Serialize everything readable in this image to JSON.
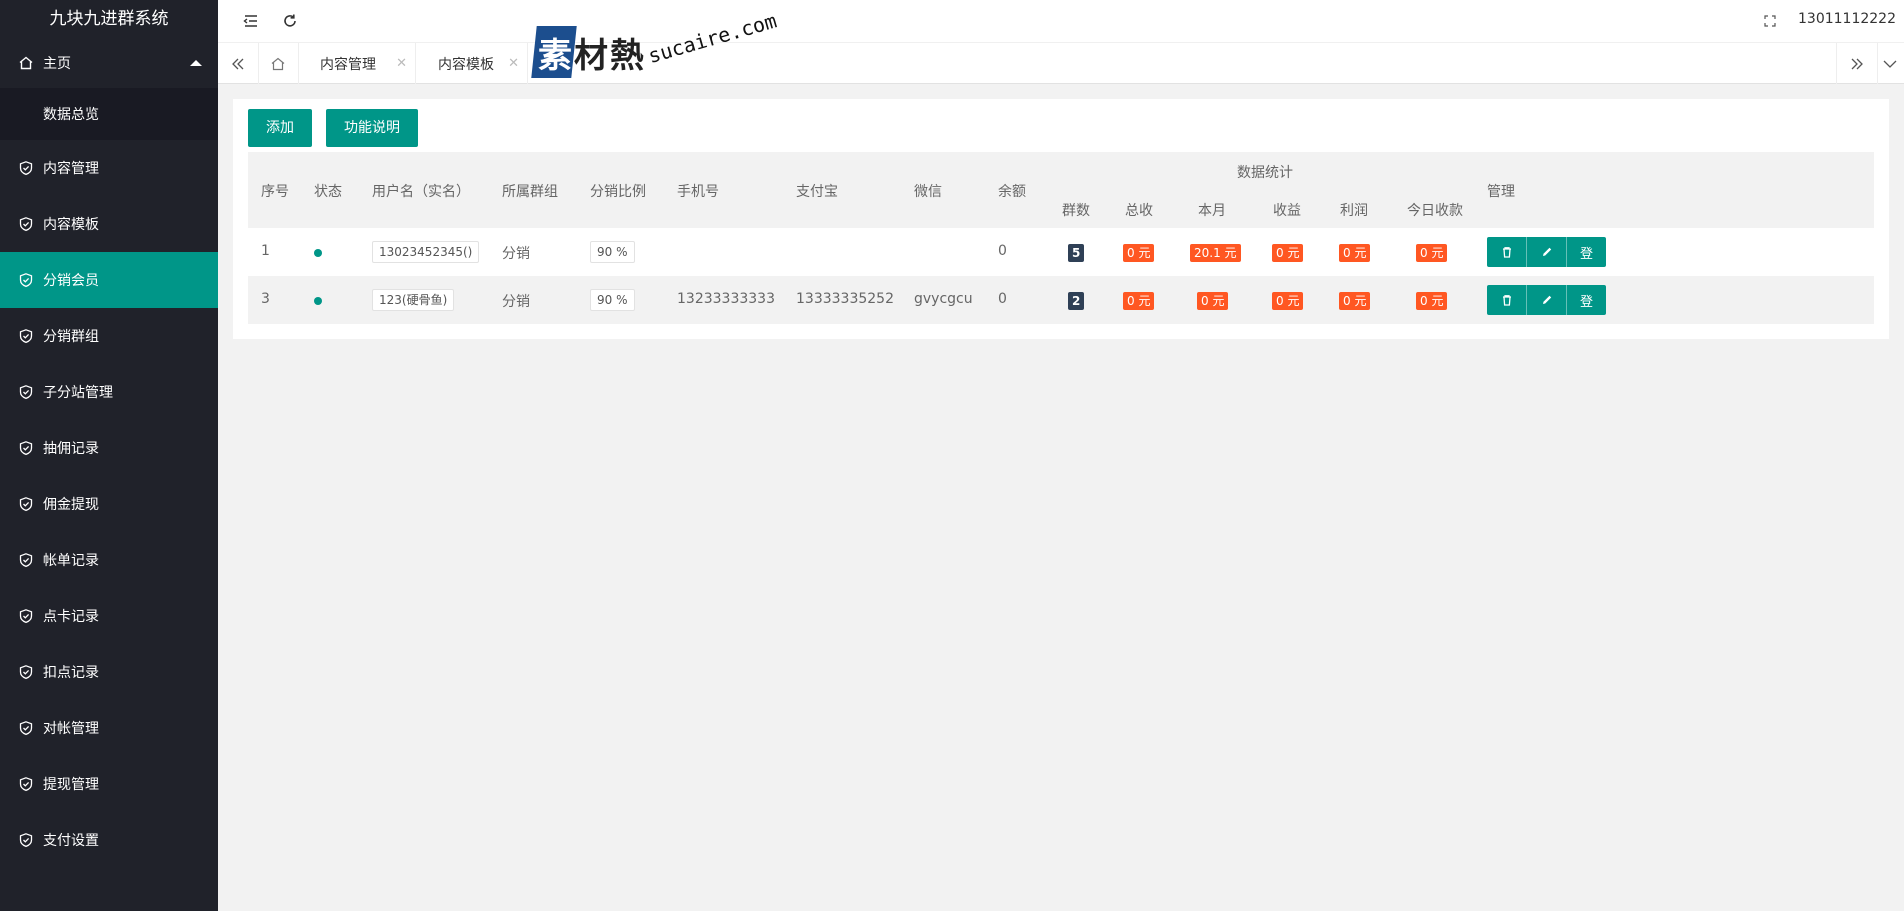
{
  "app": {
    "title": "九块九进群系统"
  },
  "sidebar": {
    "home": {
      "label": "主页",
      "sub": "数据总览"
    },
    "items": [
      {
        "label": "内容管理",
        "active": false
      },
      {
        "label": "内容模板",
        "active": false
      },
      {
        "label": "分销会员",
        "active": true
      },
      {
        "label": "分销群组",
        "active": false
      },
      {
        "label": "子分站管理",
        "active": false
      },
      {
        "label": "抽佣记录",
        "active": false
      },
      {
        "label": "佣金提现",
        "active": false
      },
      {
        "label": "帐单记录",
        "active": false
      },
      {
        "label": "点卡记录",
        "active": false
      },
      {
        "label": "扣点记录",
        "active": false
      },
      {
        "label": "对帐管理",
        "active": false
      },
      {
        "label": "提现管理",
        "active": false
      },
      {
        "label": "支付设置",
        "active": false
      }
    ]
  },
  "header": {
    "user_phone": "13011112222"
  },
  "tabs": [
    {
      "label": "内容管理"
    },
    {
      "label": "内容模板"
    }
  ],
  "watermark": {
    "text_cn": "素材熱",
    "text_en": "sucaire.com"
  },
  "toolbar": {
    "add_label": "添加",
    "help_label": "功能说明"
  },
  "table": {
    "headers": {
      "index": "序号",
      "status": "状态",
      "username": "用户名（实名）",
      "group": "所属群组",
      "ratio": "分销比例",
      "phone": "手机号",
      "alipay": "支付宝",
      "wechat": "微信",
      "balance": "余额",
      "stats_group": "数据统计",
      "manage": "管理"
    },
    "stats_headers": [
      "群数",
      "总收",
      "本月",
      "收益",
      "利润",
      "今日收款"
    ],
    "rows": [
      {
        "index": "1",
        "username": "13023452345()",
        "group": "分销",
        "ratio": "90 %",
        "phone": "",
        "alipay": "",
        "wechat": "",
        "balance": "0",
        "groups": "5",
        "total": "0 元",
        "month": "20.1 元",
        "income": "0 元",
        "profit": "0 元",
        "today": "0 元"
      },
      {
        "index": "3",
        "username": "123(硬骨鱼)",
        "group": "分销",
        "ratio": "90 %",
        "phone": "13233333333",
        "alipay": "13333335252",
        "wechat": "gvycgcu",
        "balance": "0",
        "groups": "2",
        "total": "0 元",
        "month": "0 元",
        "income": "0 元",
        "profit": "0 元",
        "today": "0 元"
      }
    ],
    "action_login_label": "登"
  }
}
